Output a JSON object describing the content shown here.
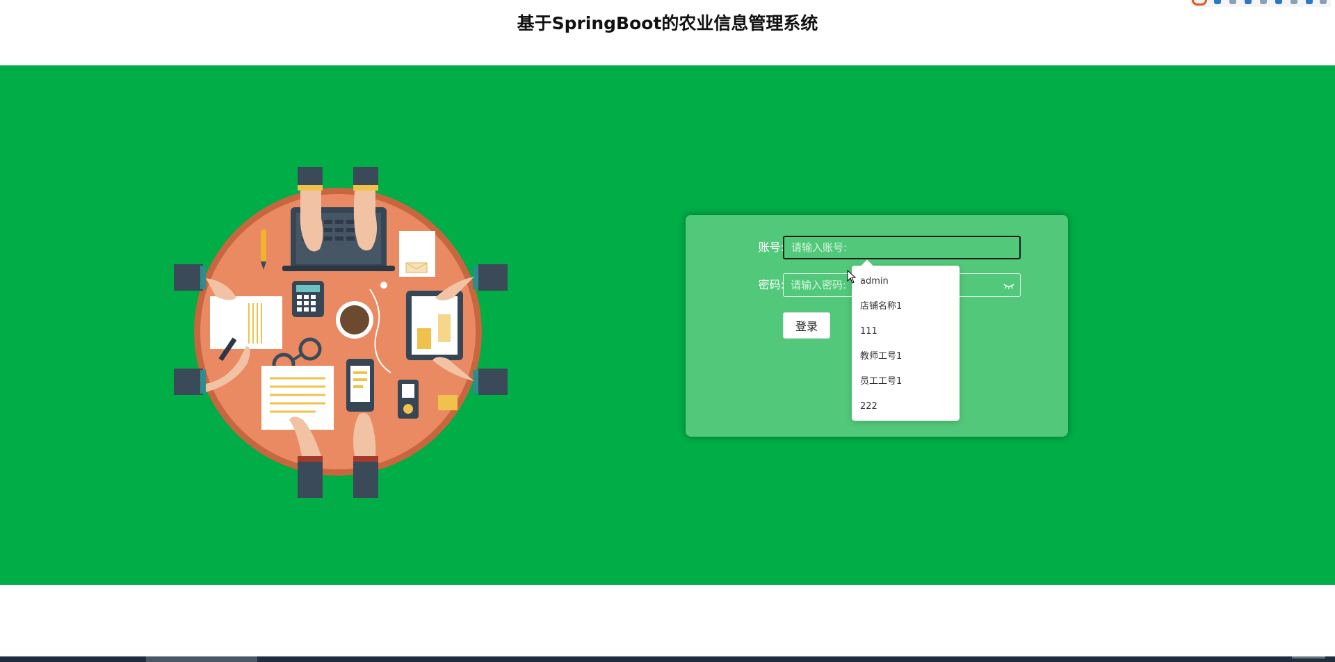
{
  "header": {
    "title": "基于SpringBoot的农业信息管理系统"
  },
  "login_form": {
    "account_label": "账号:",
    "account_placeholder": "请输入账号:",
    "password_label": "密码:",
    "password_placeholder": "请输入密码:",
    "login_button_label": "登录"
  },
  "autocomplete": {
    "items": [
      "admin",
      "店铺名称1",
      "111",
      "教师工号1",
      "员工工号1",
      "222"
    ]
  },
  "colors": {
    "background_band": "#00ad46",
    "card": "#52c97a",
    "table_top": "#e98a62"
  },
  "icons": [
    "eye-icon",
    "mouse-pointer-icon",
    "meeting-table-illustration"
  ]
}
